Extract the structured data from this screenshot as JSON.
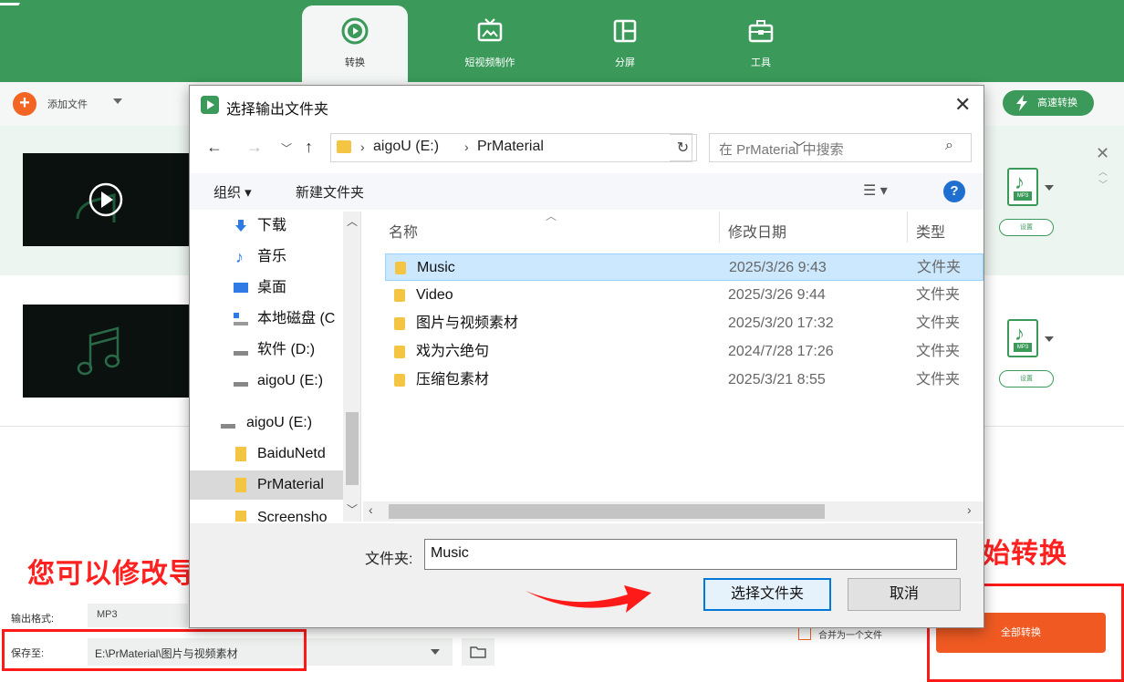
{
  "app": {
    "tabs": [
      {
        "label": "转换",
        "icon": "convert-icon",
        "active": true
      },
      {
        "label": "短视频制作",
        "icon": "tv-icon"
      },
      {
        "label": "分屏",
        "icon": "split-screen-icon"
      },
      {
        "label": "工具",
        "icon": "toolbox-icon"
      }
    ],
    "add_file": "添加文件",
    "fast_convert": "高速转换",
    "items": [
      {
        "thumb_icon": "play-icon",
        "format": "MP3",
        "settings": "设置"
      },
      {
        "thumb_icon": "music-note-icon",
        "format": "MP3",
        "settings": "设置"
      }
    ],
    "output_format_label": "输出格式:",
    "output_format_value": "MP3",
    "save_to_label": "保存至:",
    "save_to_path": "E:\\PrMaterial\\图片与视频素材",
    "merge_label": "合并为一个文件",
    "convert_all": "全部转换",
    "accent": "#3b9a5a",
    "orange": "#f05a22"
  },
  "annotations": {
    "path_hint": "您可以修改导出路径",
    "start_hint": "开始转换"
  },
  "dialog": {
    "title": "选择输出文件夹",
    "breadcrumb": [
      "aigoU (E:)",
      "PrMaterial"
    ],
    "search_placeholder": "在 PrMaterial 中搜索",
    "organize": "组织 ▾",
    "new_folder": "新建文件夹",
    "tree": [
      {
        "label": "下载",
        "icon": "download-icon"
      },
      {
        "label": "音乐",
        "icon": "music-icon"
      },
      {
        "label": "桌面",
        "icon": "desktop-icon"
      },
      {
        "label": "本地磁盘 (C",
        "icon": "drive-c-icon"
      },
      {
        "label": "软件 (D:)",
        "icon": "drive-icon"
      },
      {
        "label": "aigoU (E:)",
        "icon": "drive-icon"
      },
      {
        "label": "aigoU (E:)",
        "icon": "usb-drive-icon"
      },
      {
        "label": "BaiduNetd",
        "icon": "folder-icon"
      },
      {
        "label": "PrMaterial",
        "icon": "folder-icon",
        "selected": true
      },
      {
        "label": "Screensho",
        "icon": "folder-icon"
      }
    ],
    "columns": {
      "name": "名称",
      "date": "修改日期",
      "type": "类型"
    },
    "files": [
      {
        "name": "Music",
        "date": "2025/3/26 9:43",
        "type": "文件夹",
        "selected": true
      },
      {
        "name": "Video",
        "date": "2025/3/26 9:44",
        "type": "文件夹"
      },
      {
        "name": "图片与视频素材",
        "date": "2025/3/20 17:32",
        "type": "文件夹"
      },
      {
        "name": "戏为六绝句",
        "date": "2024/7/28 17:26",
        "type": "文件夹"
      },
      {
        "name": "压缩包素材",
        "date": "2025/3/21 8:55",
        "type": "文件夹"
      }
    ],
    "folder_label": "文件夹:",
    "folder_value": "Music",
    "ok": "选择文件夹",
    "cancel": "取消"
  }
}
